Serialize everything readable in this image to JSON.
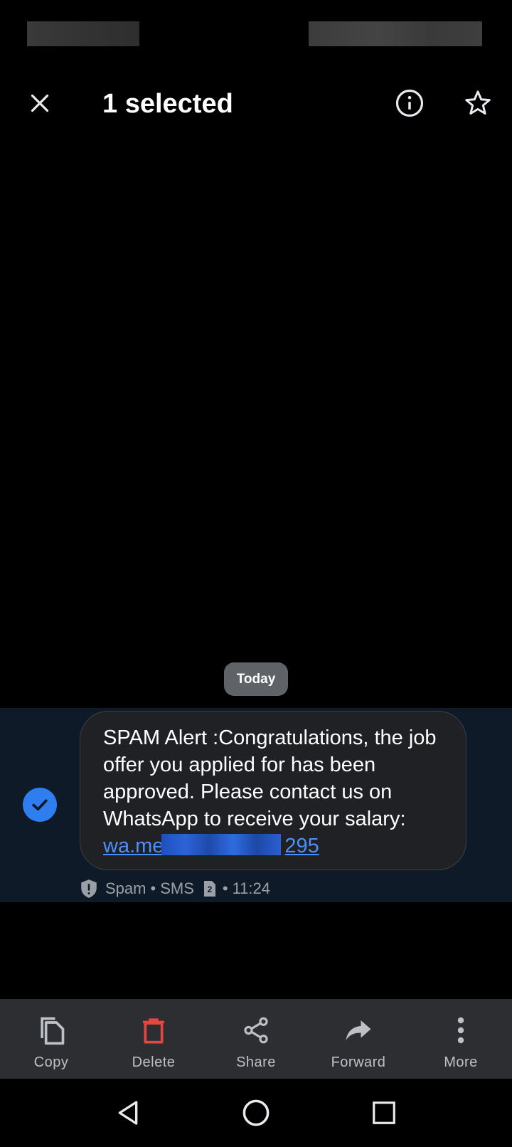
{
  "action_bar": {
    "title": "1 selected"
  },
  "conversation": {
    "date_chip": "Today",
    "message": {
      "text": "SPAM Alert :Congratulations, the job offer you applied for has been approved. Please contact us on WhatsApp to receive your salary:",
      "link_prefix": "wa.me",
      "link_suffix": "295",
      "selected": true
    },
    "meta": {
      "label": "Spam",
      "separator": "•",
      "type": "SMS",
      "sim": "2",
      "time": "11:24"
    }
  },
  "toolbar": {
    "copy": "Copy",
    "delete": "Delete",
    "share": "Share",
    "forward": "Forward",
    "more": "More"
  },
  "colors": {
    "background": "#000000",
    "selected_row": "#0f1a29",
    "bubble": "#202124",
    "accent_blue": "#2f7ef0",
    "link": "#4c8dff",
    "delete_red": "#e8453c",
    "toolbar": "#2d2e31"
  }
}
